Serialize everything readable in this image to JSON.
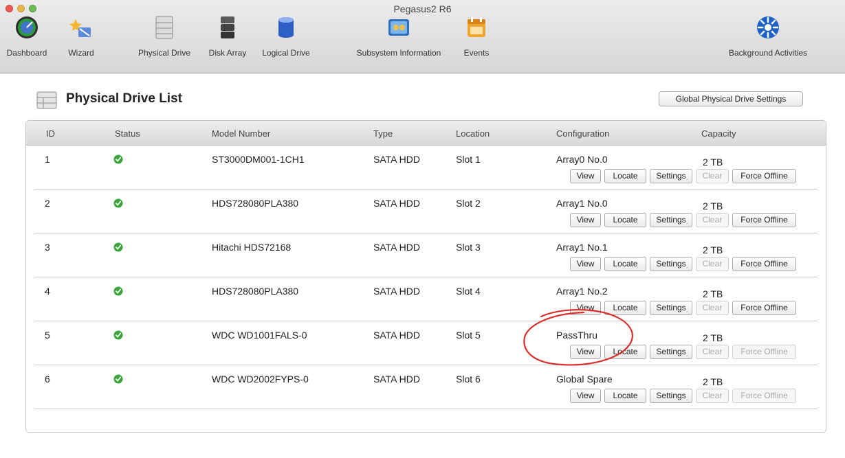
{
  "window": {
    "title": "Pegasus2 R6"
  },
  "toolbar": {
    "items": [
      {
        "label": "Dashboard",
        "icon": "dashboard-gauge-icon"
      },
      {
        "label": "Wizard",
        "icon": "wizard-icon"
      },
      {
        "label": "Physical Drive",
        "icon": "physical-drive-icon"
      },
      {
        "label": "Disk Array",
        "icon": "disk-array-icon"
      },
      {
        "label": "Logical Drive",
        "icon": "logical-drive-icon"
      },
      {
        "label": "Subsystem Information",
        "icon": "subsystem-information-icon"
      },
      {
        "label": "Events",
        "icon": "events-calendar-icon"
      },
      {
        "label": "Background Activities",
        "icon": "background-activities-icon"
      }
    ]
  },
  "page": {
    "title": "Physical Drive List",
    "global_settings_label": "Global Physical Drive Settings"
  },
  "table": {
    "columns": [
      "ID",
      "Status",
      "Model Number",
      "Type",
      "Location",
      "Configuration",
      "Capacity"
    ],
    "rows": [
      {
        "id": "1",
        "status": "ok",
        "model": "ST3000DM001-1CH1",
        "type": "SATA HDD",
        "location": "Slot 1",
        "configuration": "Array0 No.0",
        "capacity": "2 TB",
        "force_offline_enabled": true
      },
      {
        "id": "2",
        "status": "ok",
        "model": "HDS728080PLA380",
        "type": "SATA HDD",
        "location": "Slot 2",
        "configuration": "Array1 No.0",
        "capacity": "2 TB",
        "force_offline_enabled": true
      },
      {
        "id": "3",
        "status": "ok",
        "model": "Hitachi HDS72168",
        "type": "SATA HDD",
        "location": "Slot 3",
        "configuration": "Array1 No.1",
        "capacity": "2 TB",
        "force_offline_enabled": true
      },
      {
        "id": "4",
        "status": "ok",
        "model": "HDS728080PLA380",
        "type": "SATA HDD",
        "location": "Slot 4",
        "configuration": "Array1 No.2",
        "capacity": "2 TB",
        "force_offline_enabled": true
      },
      {
        "id": "5",
        "status": "ok",
        "model": "WDC WD1001FALS-0",
        "type": "SATA HDD",
        "location": "Slot 5",
        "configuration": "PassThru",
        "capacity": "2 TB",
        "force_offline_enabled": false
      },
      {
        "id": "6",
        "status": "ok",
        "model": "WDC WD2002FYPS-0",
        "type": "SATA HDD",
        "location": "Slot 6",
        "configuration": "Global Spare",
        "capacity": "2 TB",
        "force_offline_enabled": false
      }
    ],
    "row_buttons": {
      "view": "View",
      "locate": "Locate",
      "settings": "Settings",
      "clear": "Clear",
      "force_offline": "Force Offline"
    }
  },
  "colors": {
    "status_ok": "#3aa33a",
    "annotation_circle": "#d9302b"
  }
}
